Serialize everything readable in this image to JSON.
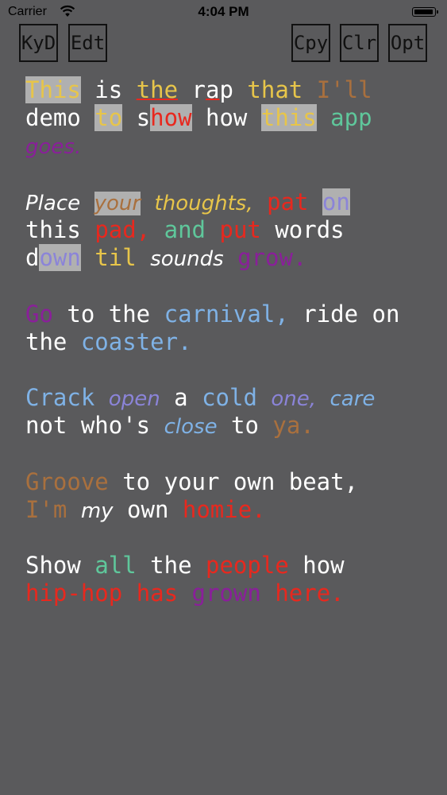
{
  "status_bar": {
    "carrier": "Carrier",
    "time": "4:04 PM"
  },
  "toolbar": {
    "kyd": "KyD",
    "edt": "Edt",
    "cpy": "Cpy",
    "clr": "Clr",
    "opt": "Opt"
  },
  "colors": {
    "background": "#5a5a5c",
    "white": "#ffffff",
    "yellow": "#e7c54a",
    "orange": "#a9703e",
    "red": "#e8281e",
    "teal": "#5fc79b",
    "purple": "#8a1f9a",
    "lavender": "#8b84d8",
    "blue": "#7fb2e6",
    "highlight": "#b0b0b0"
  },
  "lyrics": {
    "l1": {
      "w1": "This",
      "s1": " is ",
      "w2": "the",
      "s2": " r",
      "w3": "a",
      "w4": "p",
      "s3": " ",
      "w5": "that",
      "s4": " ",
      "w6": "I'll"
    },
    "l2": {
      "w1": "demo ",
      "w2": "to",
      "s1": " s",
      "w3": "how",
      "s2": " how ",
      "w4": "this",
      "s3": " ",
      "w5": "app"
    },
    "l3": {
      "w1": "goes."
    },
    "l4": {
      "w1": "Place",
      "s1": " ",
      "w2": "your",
      "s2": " ",
      "w3": "thoughts,",
      "s3": " ",
      "w4": "pat",
      "s4": " ",
      "w5": "on"
    },
    "l5": {
      "w1": "this",
      "s1": " ",
      "w2": "pad,",
      "s2": " ",
      "w3": "and",
      "s3": " ",
      "w4": "put",
      "s4": " ",
      "w5": "words"
    },
    "l6": {
      "w1": "d",
      "w2": "own",
      "s1": " ",
      "w3": "til",
      "s2": " ",
      "w4": "sounds",
      "s3": " ",
      "w5": "grow."
    },
    "l7": {
      "w1": "Go",
      "s1": " to the ",
      "w2": "carnival,",
      "s2": " ride on"
    },
    "l8": {
      "w1": "the ",
      "w2": "coaster."
    },
    "l9": {
      "w1": "Crack",
      "s1": " ",
      "w2": "open",
      "s2": " a ",
      "w3": "cold",
      "s3": " ",
      "w4": "one,",
      "s4": " ",
      "w5": "care"
    },
    "l10": {
      "w1": "not who's ",
      "w2": "close",
      "s1": " to ",
      "w3": "ya."
    },
    "l11": {
      "w1": "Groove",
      "s1": " to your own beat,"
    },
    "l12": {
      "w1": "I'm",
      "s1": " ",
      "w2": "my",
      "s2": " own ",
      "w3": "homie."
    },
    "l13": {
      "w1": "Show ",
      "w2": "all",
      "s1": " the ",
      "w3": "people",
      "s2": " how"
    },
    "l14": {
      "w1": "hip-hop",
      "s1": " ",
      "w2": "has",
      "s2": " ",
      "w3": "grown",
      "s3": " ",
      "w4": "here."
    }
  }
}
